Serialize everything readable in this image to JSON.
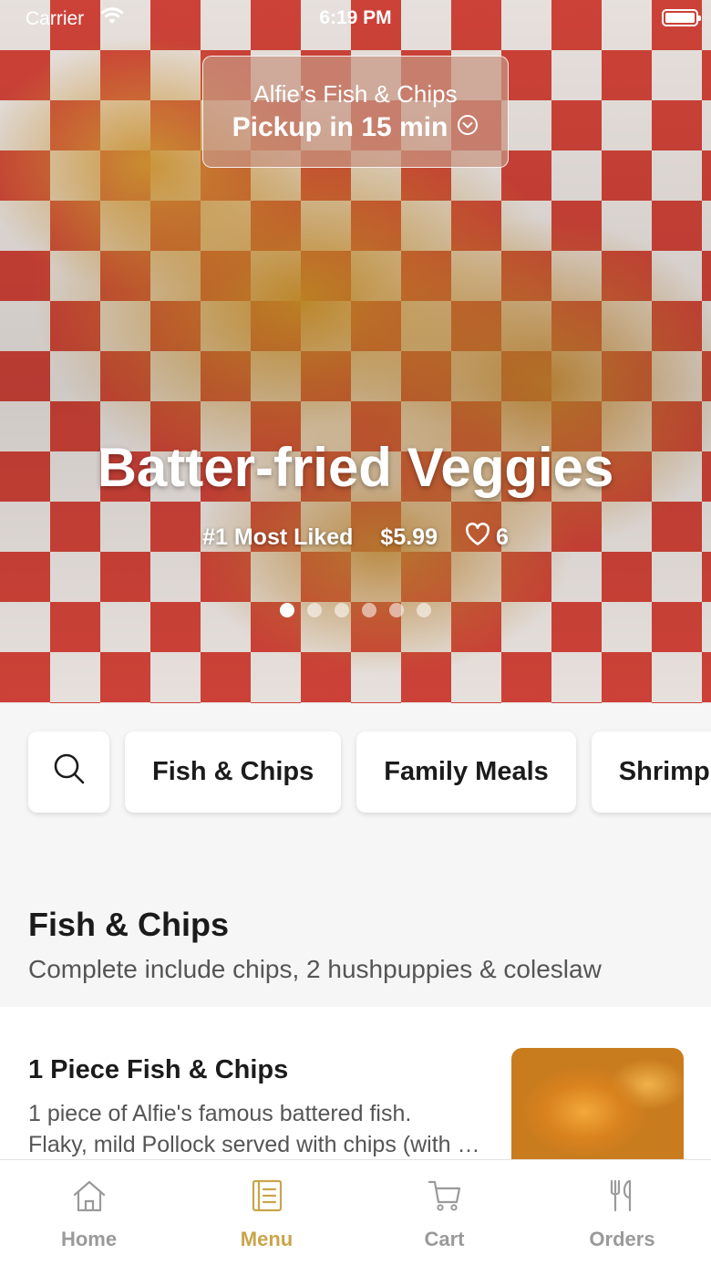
{
  "status_bar": {
    "carrier": "Carrier",
    "time": "6:19 PM"
  },
  "pickup": {
    "store": "Alfie's Fish & Chips",
    "eta": "Pickup in 15 min"
  },
  "hero": {
    "title": "Batter-fried Veggies",
    "badge": "#1 Most Liked",
    "price": "$5.99",
    "likes": "6",
    "page_count": 6,
    "active_page": 1
  },
  "categories": [
    "Fish & Chips",
    "Family Meals",
    "Shrimp"
  ],
  "section": {
    "title": "Fish & Chips",
    "description": "Complete include chips, 2 hushpuppies & coleslaw"
  },
  "item": {
    "name": "1 Piece Fish & Chips",
    "desc_line1": "1 piece of Alfie's famous battered fish.",
    "desc_line2": "Flaky, mild Pollock served with chips (with hushpuppies and coleslaw)"
  },
  "tabs": [
    {
      "label": "Home",
      "icon": "home-icon"
    },
    {
      "label": "Menu",
      "icon": "menu-icon",
      "active": true
    },
    {
      "label": "Cart",
      "icon": "cart-icon"
    },
    {
      "label": "Orders",
      "icon": "orders-icon"
    }
  ],
  "colors": {
    "accent": "#c9a54a",
    "inactive_tab": "#9a9a9a"
  }
}
